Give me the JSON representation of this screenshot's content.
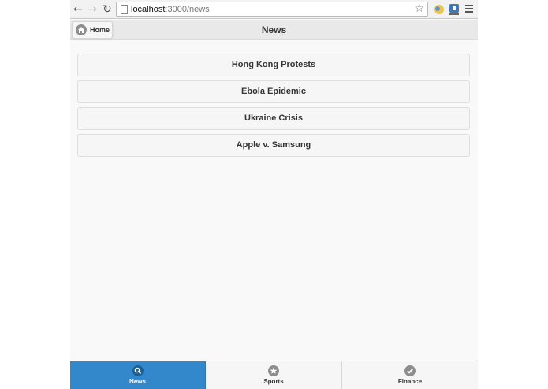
{
  "browser": {
    "url_host": "localhost",
    "url_path": ":3000/news"
  },
  "header": {
    "home_label": "Home",
    "title": "News"
  },
  "news_items": [
    {
      "label": "Hong Kong Protests"
    },
    {
      "label": "Ebola Epidemic"
    },
    {
      "label": "Ukraine Crisis"
    },
    {
      "label": "Apple v. Samsung"
    }
  ],
  "tabs": [
    {
      "label": "News",
      "icon": "search-icon",
      "active": true
    },
    {
      "label": "Sports",
      "icon": "star-icon",
      "active": false
    },
    {
      "label": "Finance",
      "icon": "check-icon",
      "active": false
    }
  ],
  "colors": {
    "active_tab": "#3388cc",
    "header_bg": "#e9e9e9",
    "page_bg": "#f9f9f9"
  }
}
